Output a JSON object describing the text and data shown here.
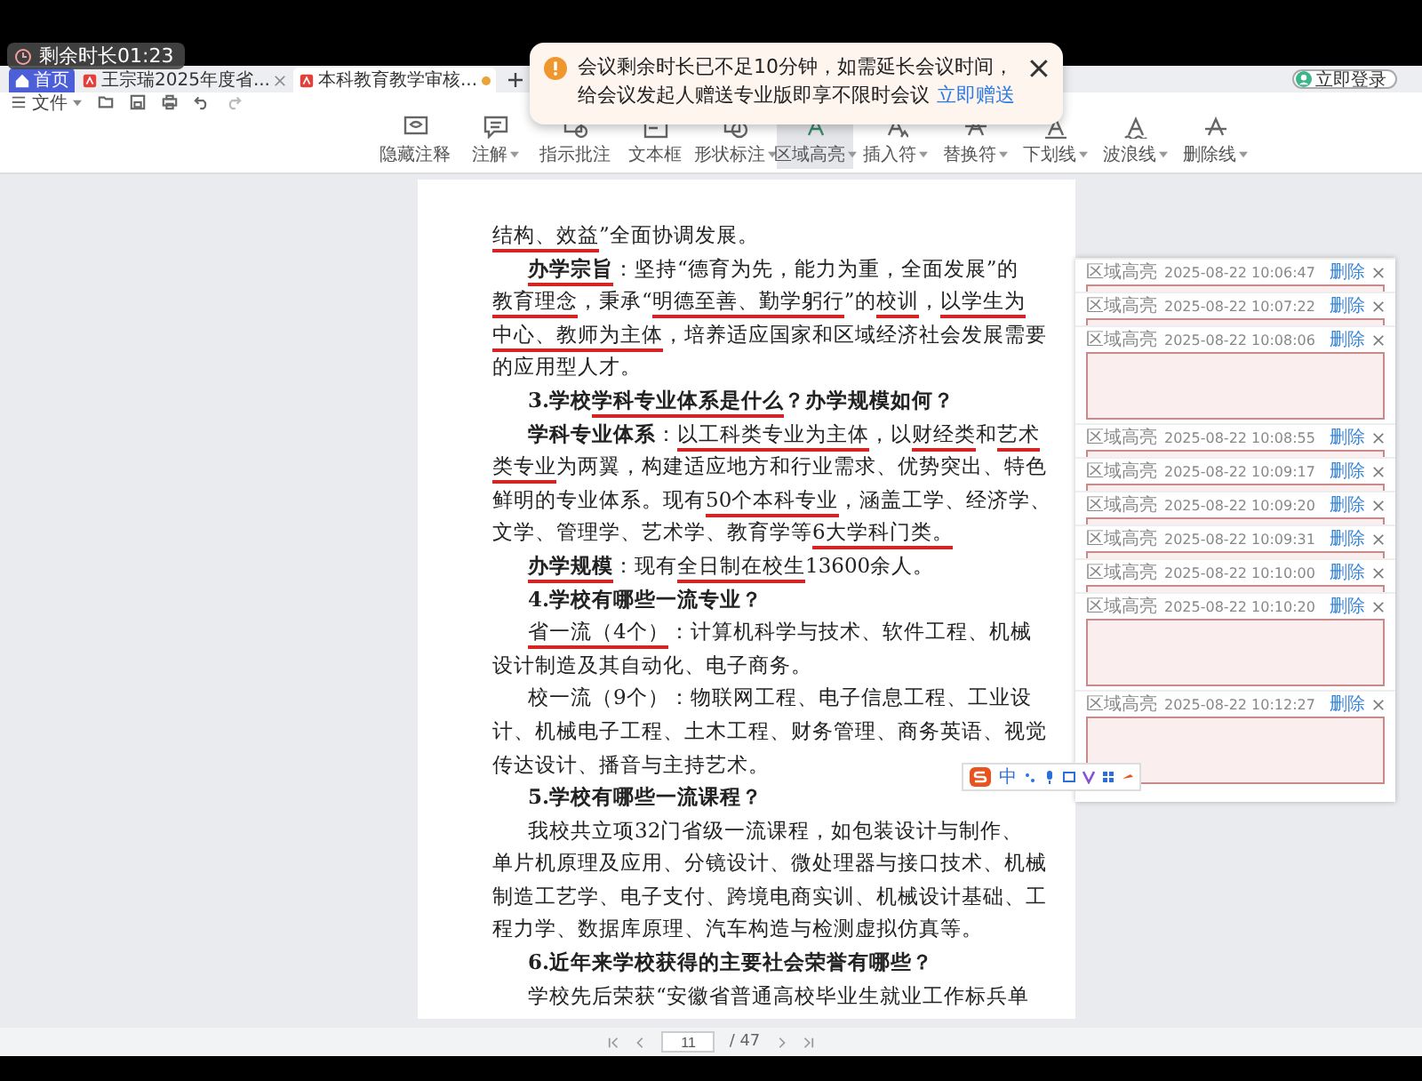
{
  "countdown": {
    "text": "剩余时长01:23"
  },
  "tabs": [
    {
      "label": "首页",
      "kind": "home",
      "selected": false,
      "modified": false
    },
    {
      "label": "王宗瑞2025年度省...",
      "kind": "pdf",
      "selected": false,
      "modified": false
    },
    {
      "label": "本科教育教学审核...",
      "kind": "pdf",
      "selected": true,
      "modified": true
    }
  ],
  "account": {
    "label": "立即登录"
  },
  "menu": {
    "label": "文件"
  },
  "ribbon": [
    {
      "label": "隐藏注释",
      "dropdown": false,
      "selected": false
    },
    {
      "label": "注解",
      "dropdown": true,
      "selected": false
    },
    {
      "label": "指示批注",
      "dropdown": false,
      "selected": false
    },
    {
      "label": "文本框",
      "dropdown": false,
      "selected": false
    },
    {
      "label": "形状标注",
      "dropdown": true,
      "selected": false
    },
    {
      "label": "区域高亮",
      "dropdown": true,
      "selected": true
    },
    {
      "label": "插入符",
      "dropdown": true,
      "selected": false
    },
    {
      "label": "替换符",
      "dropdown": true,
      "selected": false
    },
    {
      "label": "下划线",
      "dropdown": true,
      "selected": false
    },
    {
      "label": "波浪线",
      "dropdown": true,
      "selected": false
    },
    {
      "label": "删除线",
      "dropdown": true,
      "selected": false
    }
  ],
  "toast": {
    "message": "会议剩余时长已不足10分钟，如需延长会议时间，给会议发起人赠送专业版即享不限时会议",
    "link": "立即赠送"
  },
  "document": {
    "lines": [
      {
        "kind": "cont",
        "segments": [
          {
            "text": "结构、效益",
            "underlined": true
          },
          {
            "text": "”全面协调发展。",
            "underlined": false
          }
        ]
      },
      {
        "kind": "indent",
        "segments": [
          {
            "text": "**办学宗旨**",
            "underlined": true
          },
          {
            "text": "：坚持“德育为先，能力为重，全面发展”的",
            "underlined": false
          }
        ]
      },
      {
        "kind": "cont",
        "segments": [
          {
            "text": "教育理念",
            "underlined": true
          },
          {
            "text": "，秉承“",
            "underlined": false
          },
          {
            "text": "明德至善、勤学躬行",
            "underlined": true
          },
          {
            "text": "”的",
            "underlined": false
          },
          {
            "text": "校训",
            "underlined": true
          },
          {
            "text": "，",
            "underlined": false
          },
          {
            "text": "以学生为",
            "underlined": true
          }
        ]
      },
      {
        "kind": "cont",
        "segments": [
          {
            "text": "中心、教师为主体",
            "underlined": true
          },
          {
            "text": "，培养适应国家和区域经济社会发展需要",
            "underlined": false
          }
        ]
      },
      {
        "kind": "cont",
        "segments": [
          {
            "text": "的应用型人才。",
            "underlined": false
          }
        ]
      },
      {
        "kind": "heading",
        "segments": [
          {
            "text": "3.学校",
            "underlined": false
          },
          {
            "text": "学科专业体系是什么",
            "underlined": true
          },
          {
            "text": "？办学规模如何？",
            "underlined": false
          }
        ]
      },
      {
        "kind": "indent",
        "segments": [
          {
            "text": "**学科专业体系**：",
            "underlined": false
          },
          {
            "text": "以工科类专业为主体",
            "underlined": true
          },
          {
            "text": "，以",
            "underlined": false
          },
          {
            "text": "财经类",
            "underlined": true
          },
          {
            "text": "和",
            "underlined": false
          },
          {
            "text": "艺术",
            "underlined": true
          }
        ]
      },
      {
        "kind": "cont",
        "segments": [
          {
            "text": "类专业",
            "underlined": true
          },
          {
            "text": "为两翼，构建适应地方和行业需求、优势突出、特色",
            "underlined": false
          }
        ]
      },
      {
        "kind": "cont",
        "segments": [
          {
            "text": "鲜明的专业体系。现有",
            "underlined": false
          },
          {
            "text": "50个本科专业",
            "underlined": true
          },
          {
            "text": "，涵盖工学、经济学、",
            "underlined": false
          }
        ]
      },
      {
        "kind": "cont",
        "segments": [
          {
            "text": "文学、管理学、艺术学、教育学等",
            "underlined": false
          },
          {
            "text": "6大学科门类。",
            "underlined": true
          }
        ]
      },
      {
        "kind": "indent",
        "segments": [
          {
            "text": "**办学规模**",
            "underlined": true
          },
          {
            "text": "：现有",
            "underlined": false
          },
          {
            "text": "全日制在校生",
            "underlined": true
          },
          {
            "text": "13600余人。",
            "underlined": false
          }
        ]
      },
      {
        "kind": "heading",
        "segments": [
          {
            "text": "4.学校有哪些一流专业？",
            "underlined": false
          }
        ]
      },
      {
        "kind": "indent",
        "segments": [
          {
            "text": "省一流（4个）",
            "underlined": true
          },
          {
            "text": "：计算机科学与技术、软件工程、机械",
            "underlined": false
          }
        ]
      },
      {
        "kind": "cont",
        "segments": [
          {
            "text": "设计制造及其自动化、电子商务。",
            "underlined": false
          }
        ]
      },
      {
        "kind": "indent",
        "segments": [
          {
            "text": "校一流（9个）：物联网工程、电子信息工程、工业设",
            "underlined": false
          }
        ]
      },
      {
        "kind": "cont",
        "segments": [
          {
            "text": "计、机械电子工程、土木工程、财务管理、商务英语、视觉",
            "underlined": false
          }
        ]
      },
      {
        "kind": "cont",
        "segments": [
          {
            "text": "传达设计、播音与主持艺术。",
            "underlined": false
          }
        ]
      },
      {
        "kind": "heading",
        "segments": [
          {
            "text": "5.学校有哪些一流课程？",
            "underlined": false
          }
        ]
      },
      {
        "kind": "indent",
        "segments": [
          {
            "text": "我校共立项32门省级一流课程，如包装设计与制作、",
            "underlined": false
          }
        ]
      },
      {
        "kind": "cont",
        "segments": [
          {
            "text": "单片机原理及应用、分镜设计、微处理器与接口技术、机械",
            "underlined": false
          }
        ]
      },
      {
        "kind": "cont",
        "segments": [
          {
            "text": "制造工艺学、电子支付、跨境电商实训、机械设计基础、工",
            "underlined": false
          }
        ]
      },
      {
        "kind": "cont",
        "segments": [
          {
            "text": "程力学、数据库原理、汽车构造与检测虚拟仿真等。",
            "underlined": false
          }
        ]
      },
      {
        "kind": "heading",
        "segments": [
          {
            "text": "6.近年来学校获得的主要社会荣誉有哪些？",
            "underlined": false
          }
        ]
      },
      {
        "kind": "indent",
        "segments": [
          {
            "text": "学校先后荣获“安徽省普通高校毕业生就业工作标兵单",
            "underlined": false
          }
        ]
      }
    ]
  },
  "comments": [
    {
      "type": "区域高亮",
      "time": "2025-08-22 10:06:47",
      "action": "删除",
      "expanded": false
    },
    {
      "type": "区域高亮",
      "time": "2025-08-22 10:07:22",
      "action": "删除",
      "expanded": false
    },
    {
      "type": "区域高亮",
      "time": "2025-08-22 10:08:06",
      "action": "删除",
      "expanded": true
    },
    {
      "type": "区域高亮",
      "time": "2025-08-22 10:08:55",
      "action": "删除",
      "expanded": false
    },
    {
      "type": "区域高亮",
      "time": "2025-08-22 10:09:17",
      "action": "删除",
      "expanded": false
    },
    {
      "type": "区域高亮",
      "time": "2025-08-22 10:09:20",
      "action": "删除",
      "expanded": false
    },
    {
      "type": "区域高亮",
      "time": "2025-08-22 10:09:31",
      "action": "删除",
      "expanded": false
    },
    {
      "type": "区域高亮",
      "time": "2025-08-22 10:10:00",
      "action": "删除",
      "expanded": false
    },
    {
      "type": "区域高亮",
      "time": "2025-08-22 10:10:20",
      "action": "删除",
      "expanded": true
    },
    {
      "type": "区域高亮",
      "time": "2025-08-22 10:12:27",
      "action": "删除",
      "expanded": true
    }
  ],
  "ime": {
    "label": "中"
  },
  "pager": {
    "page": "11",
    "total": "/ 47"
  }
}
